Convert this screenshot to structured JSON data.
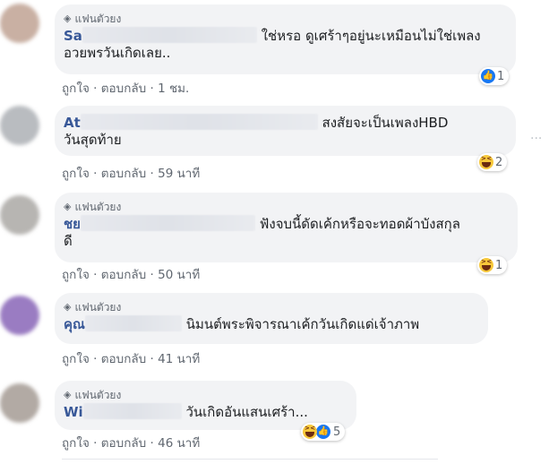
{
  "fan_badge": "แฟนตัวยง",
  "actions": {
    "like": "ถูกใจ",
    "reply": "ตอบกลับ",
    "sep": "·"
  },
  "comments": [
    {
      "name_prefix": "Sa",
      "text": "ใช่หรอ ดูเศร้าๆอยู่นะเหมือนไม่ใช่เพลง",
      "text2": "อวยพรวันเกิดเลย..",
      "time": "1 ชม.",
      "reaction_count": "1",
      "has_badge": true
    },
    {
      "name_prefix": "At",
      "text": "สงสัยจะเป็นเพลงHBD",
      "text2": "วันสุดท้าย",
      "time": "59 นาที",
      "reaction_count": "2",
      "has_badge": false
    },
    {
      "name_prefix": "ชย",
      "text": "ฟังจบนี้ดัดเค้กหรือจะทอดผ้าบังสกุล",
      "text2": "ดี",
      "time": "50 นาที",
      "reaction_count": "1",
      "has_badge": true
    },
    {
      "name_prefix": "คุณ",
      "text": "นิมนต์พระพิจารณาเค้กวันเกิดแด่เจ้าภาพ",
      "time": "41 นาที",
      "has_badge": true
    },
    {
      "name_prefix": "Wi",
      "text": "วันเกิดอันแสนเศร้า...",
      "time": "46 นาที",
      "reaction_count": "5",
      "has_badge": true
    }
  ],
  "colors": {
    "name": "#385898",
    "bubble": "#f2f3f5",
    "like": "#1877f2"
  }
}
